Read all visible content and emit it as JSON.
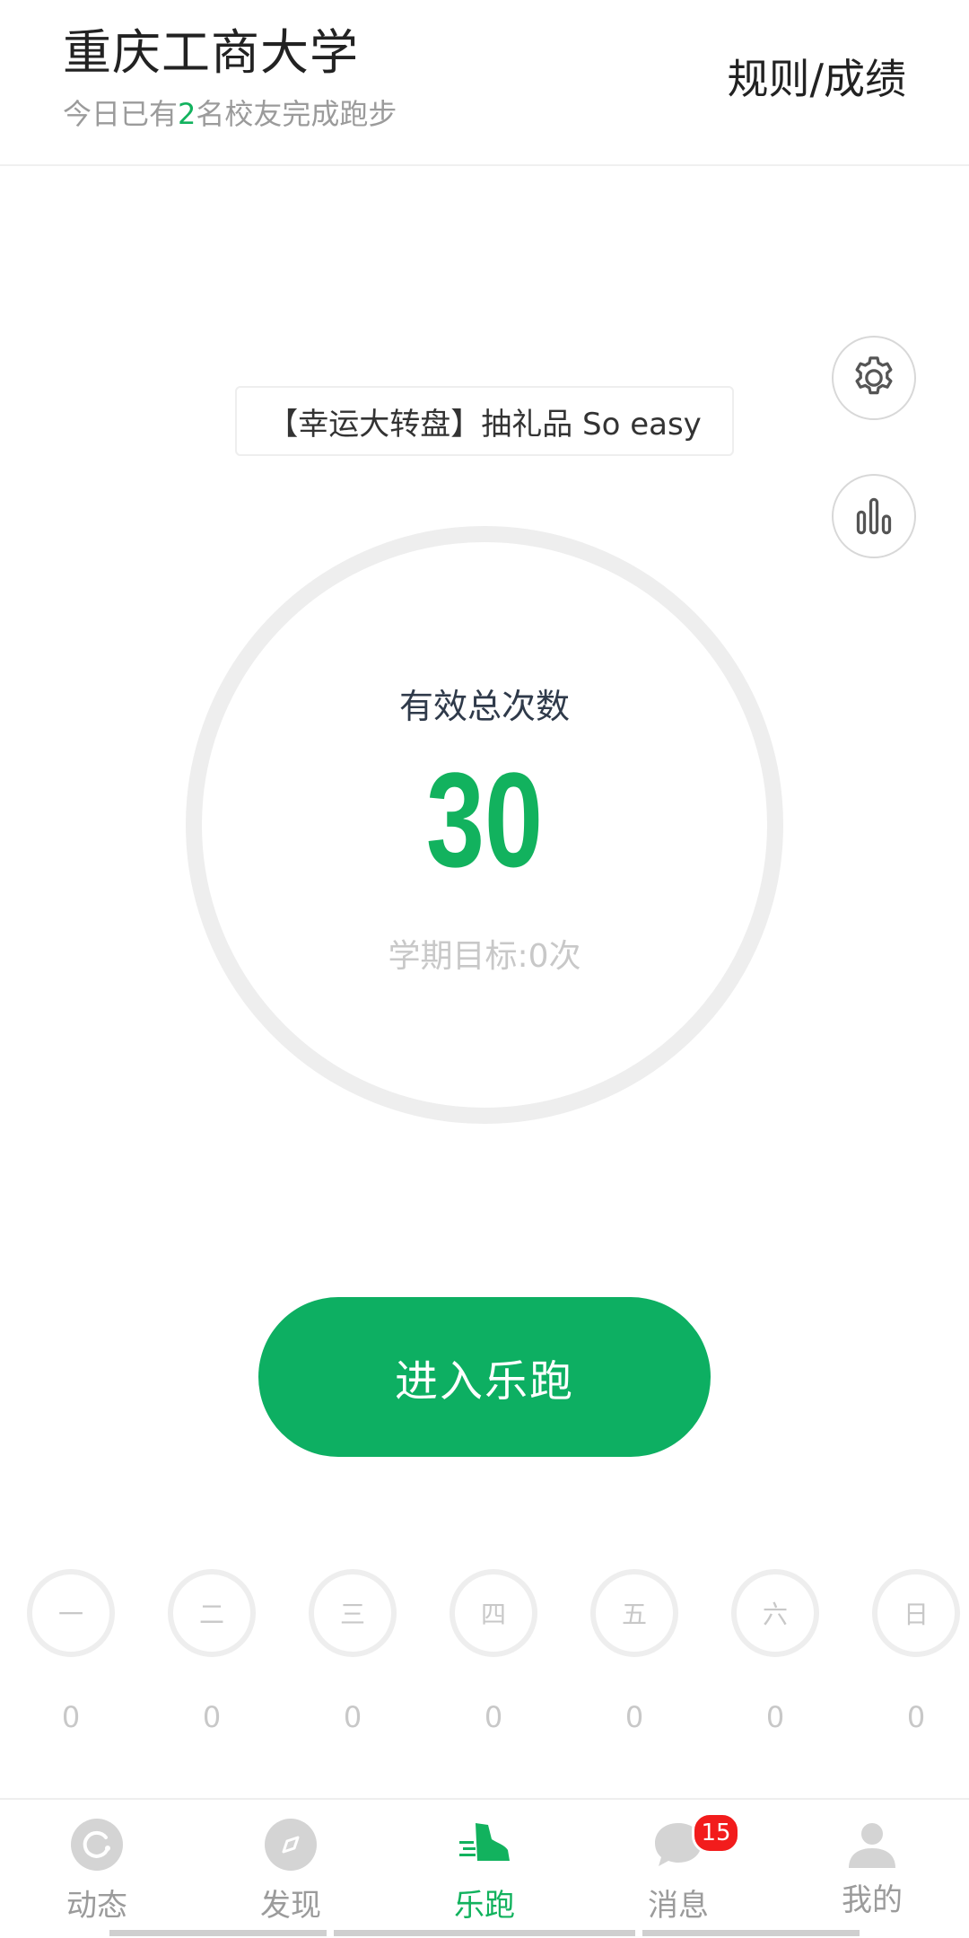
{
  "header": {
    "title": "重庆工商大学",
    "subtitle_prefix": "今日已有",
    "subtitle_count": "2",
    "subtitle_suffix": "名校友完成跑步",
    "rules_link": "规则/成绩"
  },
  "banner": {
    "text": "【幸运大转盘】抽礼品 So easy"
  },
  "ring": {
    "label": "有效总次数",
    "count": "30",
    "goal": "学期目标:0次"
  },
  "start_button": {
    "label": "进入乐跑"
  },
  "week": [
    {
      "day": "一",
      "count": "0"
    },
    {
      "day": "二",
      "count": "0"
    },
    {
      "day": "三",
      "count": "0"
    },
    {
      "day": "四",
      "count": "0"
    },
    {
      "day": "五",
      "count": "0"
    },
    {
      "day": "六",
      "count": "0"
    },
    {
      "day": "日",
      "count": "0"
    }
  ],
  "tabbar": [
    {
      "label": "动态",
      "icon": "refresh-icon",
      "active": false
    },
    {
      "label": "发现",
      "icon": "compass-icon",
      "active": false
    },
    {
      "label": "乐跑",
      "icon": "running-shoe-icon",
      "active": true
    },
    {
      "label": "消息",
      "icon": "chat-bubble-icon",
      "active": false,
      "badge": "15"
    },
    {
      "label": "我的",
      "icon": "person-icon",
      "active": false
    }
  ],
  "colors": {
    "accent": "#12b25e",
    "badge": "#f21c1c"
  }
}
